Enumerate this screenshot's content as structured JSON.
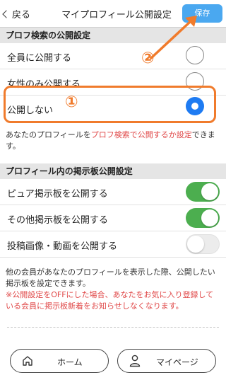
{
  "header": {
    "back_label": "戻る",
    "title": "マイプロフィール公開設定",
    "save_label": "保存"
  },
  "sections": {
    "profile_search": {
      "heading": "プロフ検索の公開設定",
      "options": [
        {
          "label": "全員に公開する",
          "selected": false
        },
        {
          "label": "女性のみ公開する",
          "selected": false
        },
        {
          "label": "公開しない",
          "selected": true
        }
      ],
      "note_prefix": "あなたのプロフィールを",
      "note_link": "プロフ検索で公開するか設定",
      "note_suffix": "できます。"
    },
    "board": {
      "heading": "プロフィール内の掲示板公開設定",
      "items": [
        {
          "label": "ピュア掲示板を公開する",
          "on": true
        },
        {
          "label": "その他掲示板を公開する",
          "on": true
        },
        {
          "label": "投稿画像・動画を公開する",
          "on": false
        }
      ],
      "note": "他の会員があなたのプロフィールを表示した際、公開したい掲示板を設定できます。",
      "warning": "※公開設定をOFFにした場合、あなたをお気に入り登録している会員に掲示板新着をお知らせしなくなります。"
    }
  },
  "annotations": {
    "step1": "①",
    "step2": "②"
  },
  "colors": {
    "accent": "#f07b2c",
    "save": "#4aa8f0",
    "radio_on": "#1e7bf2",
    "toggle_on": "#4cae4f",
    "warning": "#e04848"
  },
  "footer": {
    "home_label": "ホーム",
    "mypage_label": "マイページ"
  }
}
